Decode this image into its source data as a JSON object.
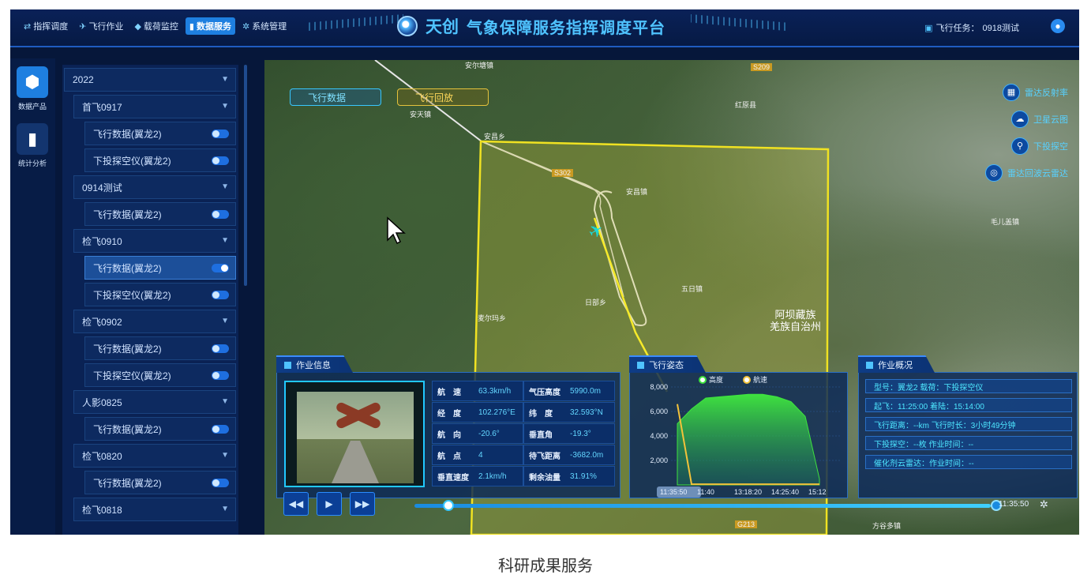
{
  "nav": {
    "items": [
      {
        "icon": "dispatch-icon",
        "label": "指挥调度"
      },
      {
        "icon": "plane-icon",
        "label": "飞行作业"
      },
      {
        "icon": "payload-icon",
        "label": "载荷监控"
      },
      {
        "icon": "bar-chart-icon",
        "label": "数据服务"
      },
      {
        "icon": "gear-icon",
        "label": "系统管理"
      }
    ]
  },
  "brand": {
    "name": "天创",
    "title": "气象保障服务指挥调度平台"
  },
  "task": {
    "label": "飞行任务：",
    "value": "0918测试"
  },
  "rail": [
    {
      "icon": "cube-icon",
      "label": "数据产品"
    },
    {
      "icon": "bar-chart-icon",
      "label": "统计分析"
    }
  ],
  "tree": [
    {
      "label": "2022"
    },
    {
      "label": "首飞0917"
    },
    {
      "label": "飞行数据(翼龙2)",
      "on": false
    },
    {
      "label": "下投探空仪(翼龙2)",
      "on": false
    },
    {
      "label": "0914测试"
    },
    {
      "label": "飞行数据(翼龙2)",
      "on": false
    },
    {
      "label": "检飞0910"
    },
    {
      "label": "飞行数据(翼龙2)",
      "on": true
    },
    {
      "label": "下投探空仪(翼龙2)",
      "on": false
    },
    {
      "label": "检飞0902"
    },
    {
      "label": "飞行数据(翼龙2)",
      "on": false
    },
    {
      "label": "下投探空仪(翼龙2)",
      "on": false
    },
    {
      "label": "人影0825"
    },
    {
      "label": "飞行数据(翼龙2)",
      "on": false
    },
    {
      "label": "检飞0820"
    },
    {
      "label": "飞行数据(翼龙2)",
      "on": false
    },
    {
      "label": "检飞0818"
    }
  ],
  "map": {
    "buttons": {
      "flight_data": "飞行数据",
      "flight_replay": "飞行回放"
    },
    "labels": [
      {
        "text": "安天镇"
      },
      {
        "text": "安昌乡"
      },
      {
        "text": "红原县"
      },
      {
        "text": "安昌镇"
      },
      {
        "text": "安尔塘镇"
      },
      {
        "text": "五日镇"
      },
      {
        "text": "毛儿盖镇"
      },
      {
        "text": "日部乡"
      },
      {
        "text": "麦尔玛乡"
      },
      {
        "text": "方谷多镇"
      },
      {
        "text": "S209"
      },
      {
        "text": "S302"
      },
      {
        "text": "G213"
      }
    ],
    "region": [
      "阿坝藏族",
      "羌族自治州"
    ],
    "layers": [
      {
        "icon": "radar-icon",
        "label": "雷达反射率"
      },
      {
        "icon": "cloud-icon",
        "label": "卫星云图"
      },
      {
        "icon": "pin-icon",
        "label": "下投探空"
      },
      {
        "icon": "scope-icon",
        "label": "雷达回波云雷达"
      }
    ]
  },
  "job_info": {
    "title": "作业信息",
    "rows": [
      [
        {
          "k": "航　速",
          "v": "63.3km/h"
        },
        {
          "k": "气压高度",
          "v": "5990.0m"
        }
      ],
      [
        {
          "k": "经　度",
          "v": "102.276°E"
        },
        {
          "k": "纬　度",
          "v": "32.593°N"
        }
      ],
      [
        {
          "k": "航　向",
          "v": "-20.6°"
        },
        {
          "k": "垂直角",
          "v": "-19.3°"
        }
      ],
      [
        {
          "k": "航　点",
          "v": "4"
        },
        {
          "k": "待飞距离",
          "v": "-3682.0m"
        }
      ],
      [
        {
          "k": "垂直速度",
          "v": "2.1km/h"
        },
        {
          "k": "剩余油量",
          "v": "31.91%"
        }
      ]
    ]
  },
  "flight_state": {
    "title": "飞行姿态"
  },
  "chart_data": {
    "type": "area",
    "legend": [
      "高度",
      "航速"
    ],
    "legend_colors": [
      "#3de23d",
      "#f2c23a"
    ],
    "ylim": [
      0,
      8000
    ],
    "y_ticks": [
      "8,000",
      "6,000",
      "4,000",
      "2,000"
    ],
    "x_ticks": [
      "11:35:50",
      "11:40",
      "13:18:20",
      "14:25:40",
      "15:12"
    ],
    "series": [
      {
        "name": "高度",
        "values": [
          5000,
          6200,
          7100,
          7200,
          7300,
          7400,
          7400,
          7200,
          6800,
          5600,
          500
        ]
      },
      {
        "name": "航速",
        "values": [
          6600,
          60,
          60,
          60,
          60,
          60,
          60,
          60,
          60,
          60,
          60
        ]
      }
    ]
  },
  "overview": {
    "title": "作业概况",
    "rows": [
      "型号：翼龙2 载荷：下投探空仪",
      "起飞：11:25:00 着陆：15:14:00",
      "飞行距离：--km 飞行时长：3小时49分钟",
      "下投探空：--枚 作业时间：--",
      "催化剂云雷达：作业时间：--"
    ]
  },
  "playback": {
    "end_time": "11:35:50"
  },
  "caption": "科研成果服务"
}
